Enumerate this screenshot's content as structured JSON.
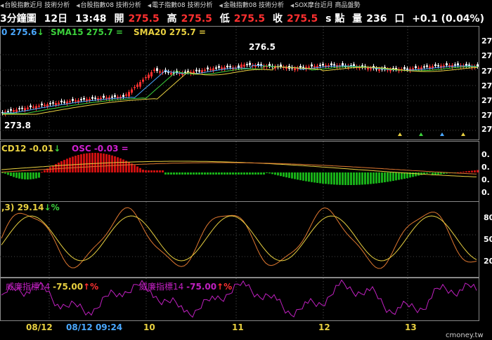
{
  "tabs": [
    {
      "label": "台股指數近月 技術分析"
    },
    {
      "label": "台股指數08 技術分析"
    },
    {
      "label": "電子指數08 技術分析"
    },
    {
      "label": "金融指數08 技術分析"
    },
    {
      "label": "SOX摩台近月 商品盤勢"
    }
  ],
  "quote": {
    "title": "3分鐘圖",
    "date": "12日",
    "time": "13:48",
    "open_label": "開",
    "open": "275.5",
    "high_label": "高",
    "high": "275.5",
    "low_label": "低",
    "low": "275.5",
    "close_label": "收",
    "close": "275.5",
    "unit": "s 點",
    "vol_label": "量",
    "volume": "236",
    "vol_unit": "口",
    "change": "+0.1 (0.04%)"
  },
  "price_panel": {
    "ma1": "0 275.6",
    "ma1_arrow": "↓",
    "sma15": "SMA15 275.7 =",
    "sma20": "SMA20 275.7 =",
    "high_mark": "276.5",
    "low_mark": "273.8",
    "right_axis": [
      "27",
      "27",
      "27",
      "27",
      "27",
      "27",
      "27"
    ]
  },
  "macd_panel": {
    "macd": "CD12 -0.01",
    "macd_arrow": "↓",
    "osc": "OSC -0.03 =",
    "right_axis": [
      "0.",
      "0.",
      "0.",
      "0."
    ]
  },
  "kd_panel": {
    "label": ",3) 29.14",
    "arrow": "↓%",
    "right_axis": [
      "80",
      "50",
      "20"
    ]
  },
  "wr_panel": {
    "label1": "威廉指標14",
    "value1": "-75.00",
    "arrow1": "↑%",
    "label2": "威廉指標14",
    "value2": "-75.00",
    "arrow2": "↑%"
  },
  "x_axis": {
    "date1": "08/12",
    "date2": "08/12 09:24",
    "ticks": [
      "10",
      "11",
      "12",
      "13"
    ]
  },
  "watermark": "cmoney.tw",
  "colors": {
    "up": "#ff3030",
    "down": "#ffffff",
    "osc_up": "#cc1010",
    "osc_down": "#18b018",
    "ma_blue": "#4aa8ff",
    "ma_green": "#3cd23c",
    "ma_yellow": "#e8d040",
    "k_line": "#e8d040",
    "d_line": "#e07830",
    "wr": "#c020c0"
  }
}
